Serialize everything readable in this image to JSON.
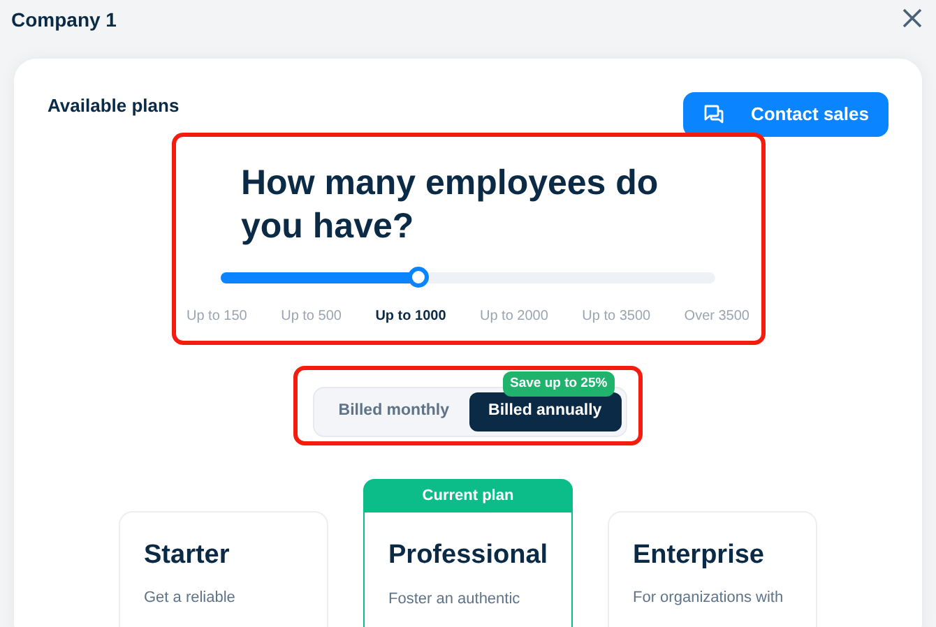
{
  "window": {
    "title": "Company 1"
  },
  "header": {
    "title": "Available plans",
    "contact_button": "Contact sales"
  },
  "employees": {
    "question": "How many employees do you have?",
    "level": 0.4,
    "options": [
      {
        "label": "Up to 150",
        "selected": false
      },
      {
        "label": "Up to 500",
        "selected": false
      },
      {
        "label": "Up to 1000",
        "selected": true
      },
      {
        "label": "Up to 2000",
        "selected": false
      },
      {
        "label": "Up to 3500",
        "selected": false
      },
      {
        "label": "Over 3500",
        "selected": false
      }
    ]
  },
  "billing": {
    "badge": "Save up to 25%",
    "options": [
      {
        "label": "Billed monthly",
        "selected": false
      },
      {
        "label": "Billed annually",
        "selected": true
      }
    ]
  },
  "plans": [
    {
      "name": "Starter",
      "description": "Get a reliable",
      "current": false
    },
    {
      "name": "Professional",
      "description": "Foster an authentic",
      "current": true,
      "current_label": "Current plan"
    },
    {
      "name": "Enterprise",
      "description": "For organizations with",
      "current": false
    }
  ]
}
